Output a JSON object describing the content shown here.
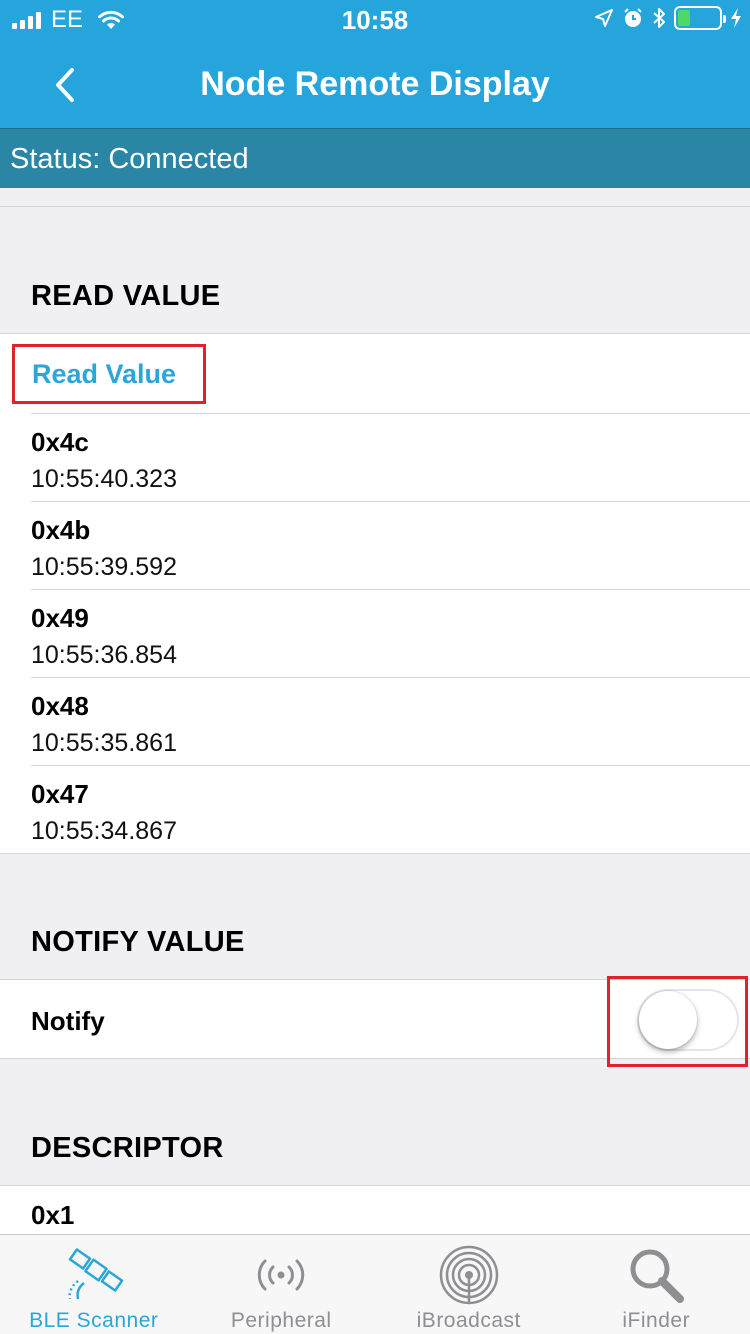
{
  "status_bar": {
    "carrier": "EE",
    "time": "10:58",
    "battery_level": 0.3
  },
  "nav": {
    "title": "Node Remote Display",
    "back_icon": "chevron-left-icon"
  },
  "connection": {
    "status_text": "Status: Connected"
  },
  "read_section": {
    "header": "READ VALUE",
    "button_label": "Read Value",
    "values": [
      {
        "hex": "0x4c",
        "time": "10:55:40.323"
      },
      {
        "hex": "0x4b",
        "time": "10:55:39.592"
      },
      {
        "hex": "0x49",
        "time": "10:55:36.854"
      },
      {
        "hex": "0x48",
        "time": "10:55:35.861"
      },
      {
        "hex": "0x47",
        "time": "10:55:34.867"
      }
    ]
  },
  "notify_section": {
    "header": "NOTIFY VALUE",
    "label": "Notify",
    "enabled": false
  },
  "descriptor_section": {
    "header": "DESCRIPTOR",
    "values": [
      {
        "hex": "0x1"
      }
    ]
  },
  "tab_bar": {
    "tabs": [
      {
        "label": "BLE Scanner",
        "icon": "satellite-icon",
        "active": true
      },
      {
        "label": "Peripheral",
        "icon": "broadcast-icon",
        "active": false
      },
      {
        "label": "iBroadcast",
        "icon": "ibeacon-icon",
        "active": false
      },
      {
        "label": "iFinder",
        "icon": "magnifier-icon",
        "active": false
      }
    ]
  },
  "colors": {
    "nav_background": "#26a5dd",
    "status_strip": "#2b86a6",
    "accent": "#2aa6d9",
    "highlight_border": "#e0232a",
    "page_background": "#efeff4"
  }
}
